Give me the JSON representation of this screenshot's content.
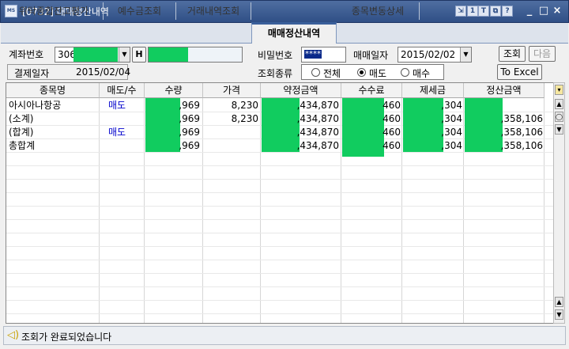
{
  "window": {
    "title": "[0732] 매매정산내역",
    "app_icon": "MS",
    "toolbar_buttons": [
      {
        "icon": "export-icon",
        "glyph": "⇲"
      },
      {
        "icon": "info-icon",
        "glyph": "1"
      },
      {
        "icon": "text-icon",
        "glyph": "T"
      },
      {
        "icon": "window-icon",
        "glyph": "⧉"
      },
      {
        "icon": "help-icon",
        "glyph": "?"
      }
    ],
    "controls": [
      {
        "icon": "minimize-icon",
        "glyph": "_"
      },
      {
        "icon": "restore-icon",
        "glyph": "□"
      },
      {
        "icon": "close-icon",
        "glyph": "×"
      }
    ]
  },
  "tabs": [
    "위탁종합잔고평가",
    "예수금조회",
    "거래내역조회",
    "매매정산내역",
    "종목변동상세"
  ],
  "form": {
    "account_label": "계좌번호",
    "account_prefix": "306",
    "h_button": "H",
    "password_label": "비밀번호",
    "password_value": "****",
    "trade_date_label": "매매일자",
    "trade_date_value": "2015/02/02",
    "settle_date_label": "결제일자",
    "settle_date_value": "2015/02/04",
    "type_label": "조회종류",
    "type_options": [
      "전체",
      "매도",
      "매수"
    ],
    "type_selected": "매도",
    "query_button": "조회",
    "next_button": "다음",
    "excel_button": "To Excel"
  },
  "grid": {
    "columns": [
      "종목명",
      "매도/수",
      "수량",
      "가격",
      "약정금액",
      "수수료",
      "제세금",
      "정산금액"
    ],
    "rows": [
      {
        "name": "아시아나항공",
        "side": "매도",
        "qty": ",969",
        "price": "8,230",
        "amount": ",434,870",
        "fee": "460",
        "tax": ",304",
        "settle": ""
      },
      {
        "name": "(소계)",
        "side": "",
        "qty": ",969",
        "price": "8,230",
        "amount": ",434,870",
        "fee": "460",
        "tax": ",304",
        "settle": ",358,106"
      },
      {
        "name": "(합계)",
        "side": "매도",
        "qty": ",969",
        "price": "",
        "amount": ",434,870",
        "fee": "460",
        "tax": ",304",
        "settle": ",358,106"
      },
      {
        "name": "총합계",
        "side": "",
        "qty": ",969",
        "price": "",
        "amount": ",434,870",
        "fee": "460",
        "tax": ",304",
        "settle": ",358,106"
      }
    ]
  },
  "status": {
    "message": "조회가 완료되었습니다"
  },
  "colors": {
    "redaction": "#11cc5f",
    "title_bar": "#2f4f86",
    "side_text": "#0000cc"
  }
}
